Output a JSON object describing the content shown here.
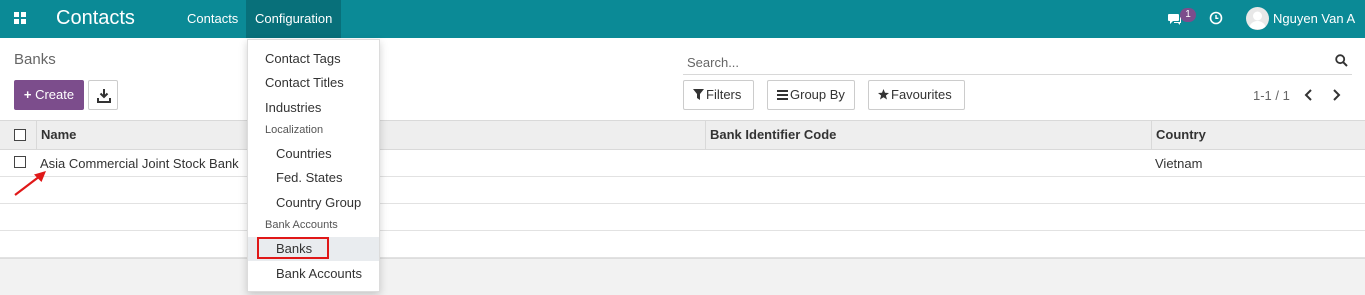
{
  "navbar": {
    "app_title": "Contacts",
    "menu": [
      "Contacts",
      "Configuration"
    ],
    "chat_badge": "1",
    "user_name": "Nguyen Van A",
    "icons": [
      "apps-grid-icon",
      "chat-icon",
      "clock-icon",
      "avatar"
    ],
    "colors": {
      "bar": "#0b8a96",
      "active_menu": "#08707a",
      "badge": "#7c4d8c"
    }
  },
  "control_panel": {
    "breadcrumb": "Banks",
    "search_placeholder": "Search...",
    "create_label": "Create",
    "filters_label": "Filters",
    "groupby_label": "Group By",
    "favourites_label": "Favourites",
    "pager": "1-1 / 1",
    "create_color": "#7c4d8c"
  },
  "list": {
    "columns": [
      "Name",
      "Bank Identifier Code",
      "Country"
    ],
    "rows": [
      {
        "name": "Asia Commercial Joint Stock Bank",
        "bic": "",
        "country": "Vietnam"
      }
    ]
  },
  "dropdown": {
    "items": [
      {
        "label": "Contact Tags"
      },
      {
        "label": "Contact Titles"
      },
      {
        "label": "Industries"
      }
    ],
    "localization_header": "Localization",
    "localization_items": [
      "Countries",
      "Fed. States",
      "Country Group"
    ],
    "bank_header": "Bank Accounts",
    "bank_items": [
      "Banks",
      "Bank Accounts"
    ],
    "active_item": "Banks",
    "highlight_color": "#e01818"
  }
}
